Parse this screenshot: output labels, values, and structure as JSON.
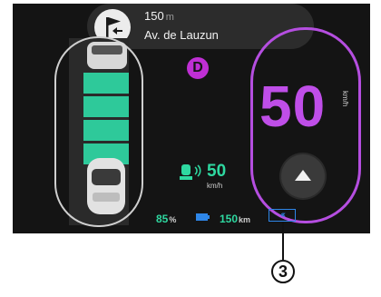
{
  "navigation": {
    "distance_value": "150",
    "distance_unit": "m",
    "street": "Av. de Lauzun",
    "maneuver_icon": "flag-turn-icon"
  },
  "lane_assist": {
    "segments": 4,
    "car_icon": "car-icon"
  },
  "gear": "D",
  "speed": {
    "value": "50",
    "unit": "km/h"
  },
  "speed_limit": {
    "value": "50",
    "unit": "km/h",
    "icon": "adaptive-cruise-icon"
  },
  "battery": {
    "percent_value": "85",
    "percent_unit": "%",
    "range_value": "150",
    "range_unit": "km",
    "battery_icon": "battery-icon",
    "regen_icon": "regen-braking-icon"
  },
  "callout": {
    "label": "3"
  },
  "colors": {
    "screen_bg": "#141414",
    "accent_purple": "#bf4ee8",
    "accent_green": "#2ed8a0",
    "accent_blue": "#2e86e8",
    "lane_green": "#2ec99a"
  }
}
